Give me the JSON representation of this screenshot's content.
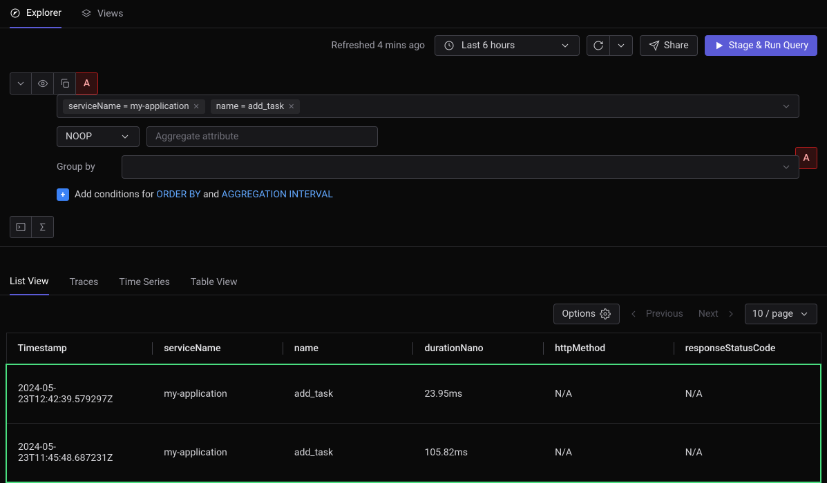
{
  "topTabs": {
    "explorer": "Explorer",
    "views": "Views"
  },
  "toolbar": {
    "refreshed": "Refreshed 4 mins ago",
    "timeRange": "Last 6 hours",
    "share": "Share",
    "runQuery": "Stage & Run Query"
  },
  "query": {
    "letter": "A",
    "filters": [
      "serviceName = my-application",
      "name = add_task"
    ],
    "noop": "NOOP",
    "aggregatePlaceholder": "Aggregate attribute",
    "groupByLabel": "Group by",
    "conditions": {
      "prefix": "Add conditions for ",
      "orderBy": "ORDER BY",
      "and": " and ",
      "aggInterval": "AGGREGATION INTERVAL"
    }
  },
  "viewTabs": {
    "list": "List View",
    "traces": "Traces",
    "timeSeries": "Time Series",
    "table": "Table View"
  },
  "tableControls": {
    "options": "Options",
    "previous": "Previous",
    "next": "Next",
    "pageSize": "10 / page"
  },
  "columns": [
    "Timestamp",
    "serviceName",
    "name",
    "durationNano",
    "httpMethod",
    "responseStatusCode"
  ],
  "rows": [
    {
      "timestamp": "2024-05-23T12:42:39.579297Z",
      "serviceName": "my-application",
      "name": "add_task",
      "durationNano": "23.95ms",
      "httpMethod": "N/A",
      "responseStatusCode": "N/A"
    },
    {
      "timestamp": "2024-05-23T11:45:48.687231Z",
      "serviceName": "my-application",
      "name": "add_task",
      "durationNano": "105.82ms",
      "httpMethod": "N/A",
      "responseStatusCode": "N/A"
    }
  ]
}
